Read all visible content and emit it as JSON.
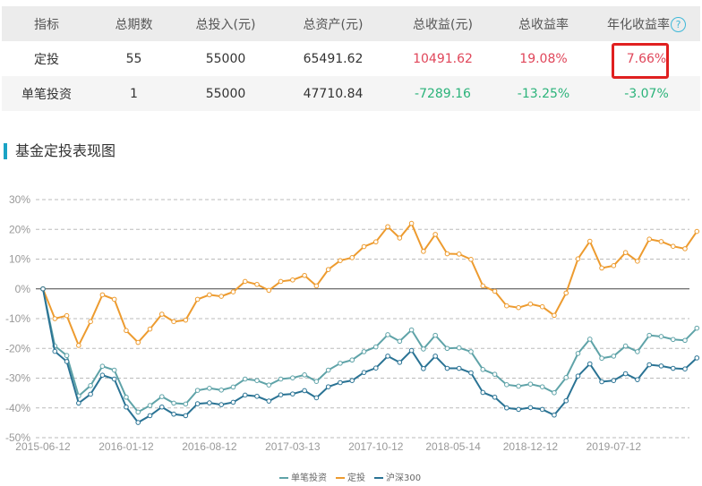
{
  "table": {
    "headers": [
      "指标",
      "总期数",
      "总投入(元)",
      "总资产(元)",
      "总收益(元)",
      "总收益率",
      "年化收益率"
    ],
    "help_icon": "?",
    "rows": [
      [
        "定投",
        "55",
        "55000",
        "65491.62",
        "10491.62",
        "19.08%",
        "7.66%"
      ],
      [
        "单笔投资",
        "1",
        "55000",
        "47710.84",
        "-7289.16",
        "-13.25%",
        "-3.07%"
      ]
    ]
  },
  "section_title": "基金定投表现图",
  "colors": {
    "dca": "#ed9b2f",
    "lump": "#5fa3a8",
    "hs300": "#2a7394",
    "positive": "#e0465a",
    "negative": "#2bb37a"
  },
  "chart_data": {
    "type": "line",
    "ylim": [
      -50,
      30
    ],
    "yticks": [
      "30%",
      "20%",
      "10%",
      "0%",
      "-10%",
      "-20%",
      "-30%",
      "-40%",
      "-50%"
    ],
    "ytick_values": [
      30,
      20,
      10,
      0,
      -10,
      -20,
      -30,
      -40,
      -50
    ],
    "n_points": 55,
    "xtick_labels": [
      "2015-06-12",
      "2016-01-12",
      "2016-08-12",
      "2017-03-13",
      "2017-10-12",
      "2018-05-14",
      "2018-12-12",
      "2019-07-12"
    ],
    "xtick_index": [
      0,
      7,
      14,
      21,
      28,
      34.5,
      41,
      48
    ],
    "legend": [
      "单笔投资",
      "定投",
      "沪深300"
    ],
    "series": [
      {
        "name": "单笔投资",
        "values": [
          0,
          -19.2,
          -22.4,
          -36,
          -32.5,
          -26,
          -27.3,
          -36.4,
          -41.4,
          -39.2,
          -36.2,
          -38.4,
          -38.7,
          -34.1,
          -33.4,
          -34,
          -33,
          -30.3,
          -30.8,
          -32.3,
          -30.3,
          -29.9,
          -28.9,
          -31.1,
          -27.3,
          -25,
          -23.9,
          -21.1,
          -19.5,
          -15.4,
          -17.6,
          -13.8,
          -20.2,
          -15.6,
          -20,
          -19.8,
          -21.1,
          -27.1,
          -28.7,
          -32.2,
          -32.7,
          -32,
          -32.9,
          -34.9,
          -29.8,
          -21.7,
          -16.9,
          -23.3,
          -22.6,
          -19.2,
          -21.1,
          -15.6,
          -16,
          -17,
          -17.3,
          -13.2
        ]
      },
      {
        "name": "定投",
        "values": [
          0,
          -10,
          -9,
          -19,
          -11,
          -2,
          -3.5,
          -14,
          -18,
          -13.5,
          -8.5,
          -11,
          -10.5,
          -3.5,
          -2,
          -2.5,
          -1,
          2.5,
          1.5,
          -0.5,
          2.5,
          3,
          4.5,
          1,
          6.5,
          9.5,
          10.5,
          14.2,
          15.8,
          20.9,
          17.1,
          22,
          12.6,
          18.3,
          11.8,
          11.7,
          9.9,
          1,
          -0.8,
          -5.7,
          -6.3,
          -5.1,
          -6,
          -8.9,
          -1.4,
          10.1,
          16,
          7,
          7.8,
          12.2,
          9.3,
          16.7,
          15.9,
          14.3,
          13.5,
          19.3
        ]
      },
      {
        "name": "沪深300",
        "values": [
          0,
          -21,
          -24.4,
          -38.4,
          -35.4,
          -29,
          -30.3,
          -39.7,
          -44.9,
          -42.6,
          -39.7,
          -42.1,
          -42.6,
          -38.6,
          -38.3,
          -38.9,
          -38.1,
          -35.7,
          -36.1,
          -37.7,
          -35.6,
          -35.3,
          -34.2,
          -36.6,
          -32.9,
          -31.5,
          -30.8,
          -28.1,
          -26.6,
          -22.6,
          -24.7,
          -20.7,
          -26.8,
          -22.6,
          -26.7,
          -26.7,
          -28.2,
          -34.8,
          -36.4,
          -40,
          -40.5,
          -39.9,
          -40.5,
          -42.4,
          -37.6,
          -29.3,
          -25.2,
          -31.2,
          -30.8,
          -28.5,
          -30.5,
          -25.5,
          -25.9,
          -26.7,
          -26.9,
          -23.2
        ]
      }
    ]
  }
}
